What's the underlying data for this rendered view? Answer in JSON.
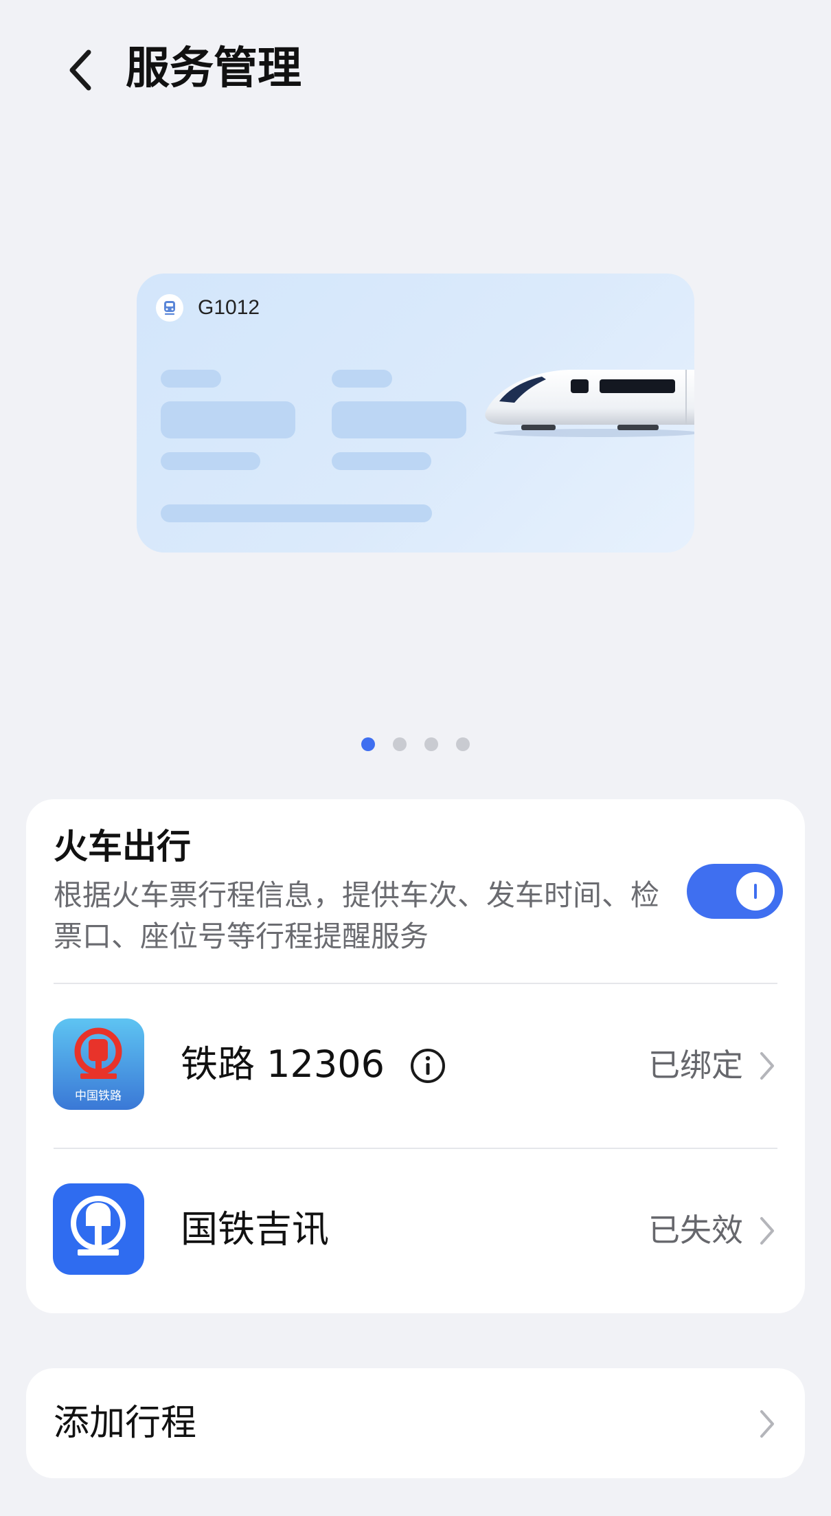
{
  "header": {
    "title": "服务管理",
    "back_icon": "chevron-left-icon"
  },
  "illustration": {
    "train_number": "G1012",
    "icon": "train-icon"
  },
  "pager": {
    "count": 4,
    "active_index": 0
  },
  "service": {
    "title": "火车出行",
    "description": "根据火车票行程信息，提供车次、发车时间、检票口、座位号等行程提醒服务",
    "toggle_on": true
  },
  "apps": [
    {
      "name": "铁路 12306",
      "logo_caption": "中国铁路",
      "status": "已绑定",
      "has_info": true
    },
    {
      "name": "国铁吉讯",
      "status": "已失效",
      "has_info": false
    }
  ],
  "add_trip": {
    "label": "添加行程"
  },
  "colors": {
    "accent": "#3f6ff0",
    "background": "#f1f2f6",
    "card": "#ffffff",
    "secondary_text": "#66676c"
  }
}
